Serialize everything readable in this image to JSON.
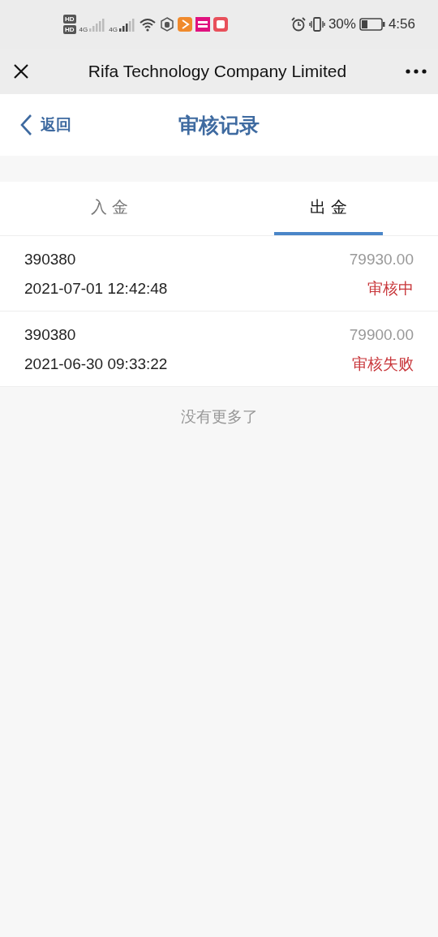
{
  "status_bar": {
    "hd_badges": [
      "HD",
      "HD"
    ],
    "networks": [
      "4G",
      "4G"
    ],
    "battery": "30%",
    "time": "4:56"
  },
  "window": {
    "title": "Rifa Technology Company Limited"
  },
  "header": {
    "back": "返回",
    "title": "审核记录"
  },
  "tabs": [
    {
      "label": "入 金",
      "selected": false
    },
    {
      "label": "出 金",
      "selected": true
    }
  ],
  "records": [
    {
      "id": "390380",
      "amount": "79930.00",
      "time": "2021-07-01 12:42:48",
      "status": "审核中"
    },
    {
      "id": "390380",
      "amount": "79900.00",
      "time": "2021-06-30 09:33:22",
      "status": "审核失败"
    }
  ],
  "footer": "没有更多了"
}
